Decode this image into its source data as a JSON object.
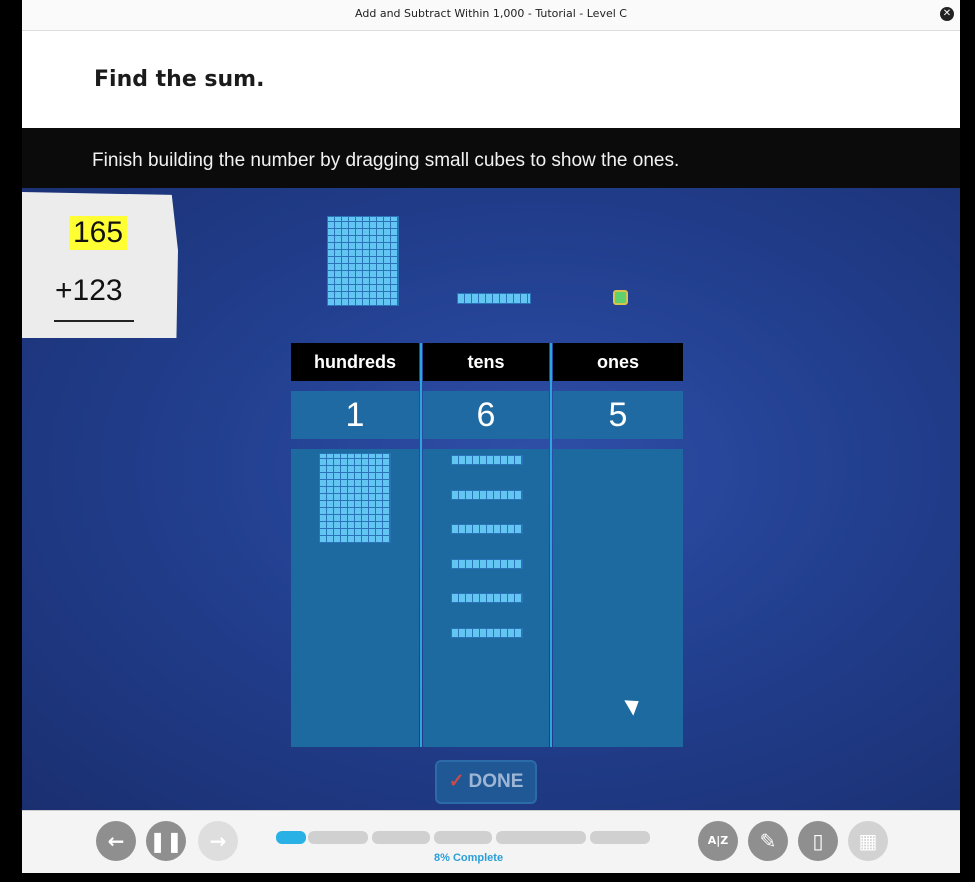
{
  "window": {
    "title": "Add and Subtract Within 1,000 - Tutorial - Level C"
  },
  "question": {
    "text": "Find the sum."
  },
  "instruction": {
    "text": "Finish building the number by dragging small cubes to show the ones."
  },
  "problem": {
    "addend1": "165",
    "addend2": "+123"
  },
  "place_value": {
    "headers": {
      "hundreds": "hundreds",
      "tens": "tens",
      "ones": "ones"
    },
    "digits": {
      "hundreds": "1",
      "tens": "6",
      "ones": "5"
    },
    "blocks": {
      "hundreds": 1,
      "tens": 6,
      "ones": 0
    }
  },
  "done_button": {
    "check": "✓",
    "label": "DONE"
  },
  "progress": {
    "value_percent": 8,
    "text": "8% Complete"
  },
  "toolbar": {
    "back_icon": "←",
    "pause_icon": "❚❚",
    "forward_icon": "→",
    "glossary_icon": "A|Z",
    "pencil_icon": "✎",
    "clipboard_icon": "▯",
    "calculator_icon": "▦"
  },
  "colors": {
    "accent_blue": "#29b1e6",
    "highlight_yellow": "#ffff33",
    "base_block": "#63c6f2"
  }
}
